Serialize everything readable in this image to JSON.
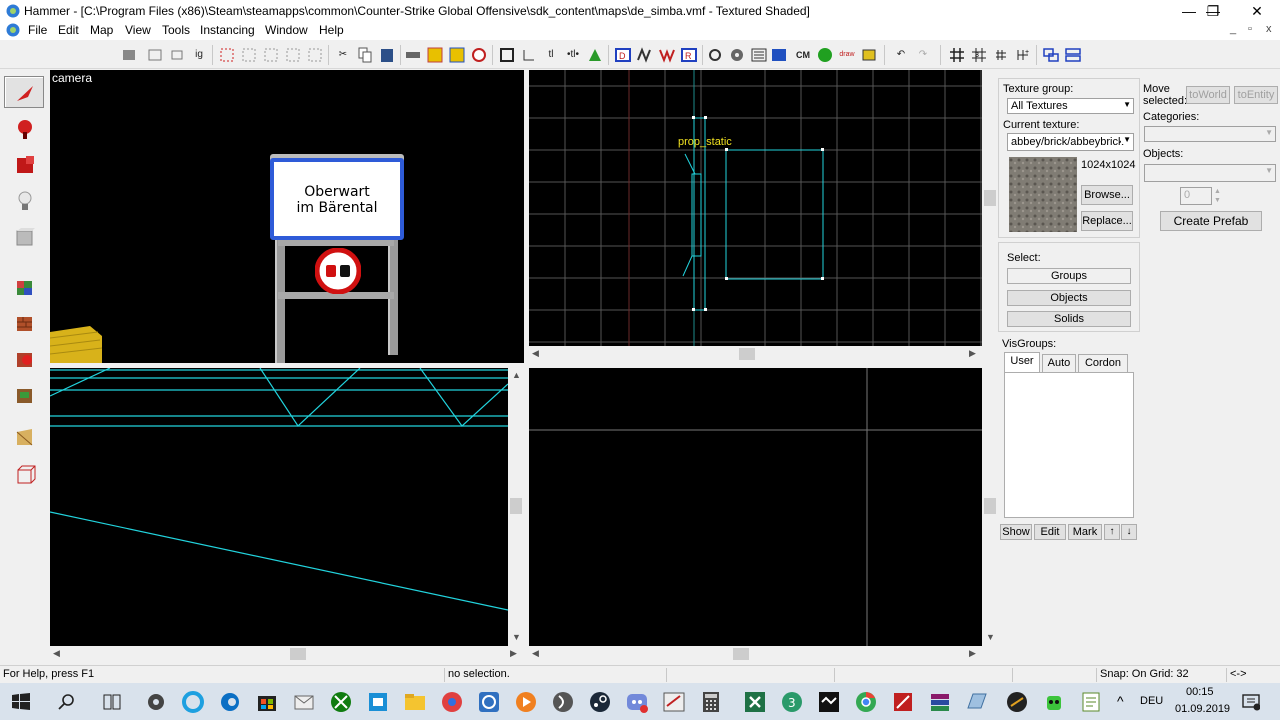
{
  "window": {
    "title": "Hammer - [C:\\Program Files (x86)\\Steam\\steamapps\\common\\Counter-Strike Global Offensive\\sdk_content\\maps\\de_simba.vmf - Textured Shaded]",
    "minimize": "—",
    "maximize": "❐",
    "close": "✕"
  },
  "menu": {
    "items": [
      "File",
      "Edit",
      "Map",
      "View",
      "Tools",
      "Instancing",
      "Window",
      "Help"
    ],
    "mdi_controls": [
      "_",
      "▫",
      "x"
    ]
  },
  "toolbar": {
    "ig_label": "ig",
    "tl_label": "tl",
    "tltl_label": "•tl•",
    "cm_label": "CM",
    "draw_label": "draw"
  },
  "viewports": {
    "camera_label": "camera",
    "sign_line1": "Oberwart",
    "sign_line2": "im Bärental",
    "prop_label": "prop_static"
  },
  "texture_panel": {
    "group_label": "Texture group:",
    "group_value": "All Textures",
    "current_label": "Current texture:",
    "current_value": "abbey/brick/abbeybrick",
    "size": "1024x1024",
    "browse": "Browse...",
    "replace": "Replace..."
  },
  "move_panel": {
    "move_label": "Move",
    "selected_label": "selected:",
    "to_world": "toWorld",
    "to_entity": "toEntity",
    "categories_label": "Categories:",
    "objects_label": "Objects:",
    "count": "0",
    "create_prefab": "Create Prefab"
  },
  "select_panel": {
    "label": "Select:",
    "groups": "Groups",
    "objects": "Objects",
    "solids": "Solids"
  },
  "visgroups": {
    "label": "VisGroups:",
    "tabs": [
      "User",
      "Auto",
      "Cordon"
    ],
    "show": "Show",
    "edit": "Edit",
    "mark": "Mark",
    "up": "🠕",
    "down": "🠗"
  },
  "statusbar": {
    "help": "For Help, press F1",
    "selection": "no selection.",
    "snap": "Snap: On Grid: 32",
    "arrows": "<->"
  },
  "taskbar": {
    "lang": "DEU",
    "time": "00:15",
    "date": "01.09.2019",
    "chevron": "^"
  },
  "colors": {
    "wire": "#22d3dd",
    "grid": "#555555",
    "viewport_bg": "#000000",
    "taskbar": "#d9e2ec"
  }
}
